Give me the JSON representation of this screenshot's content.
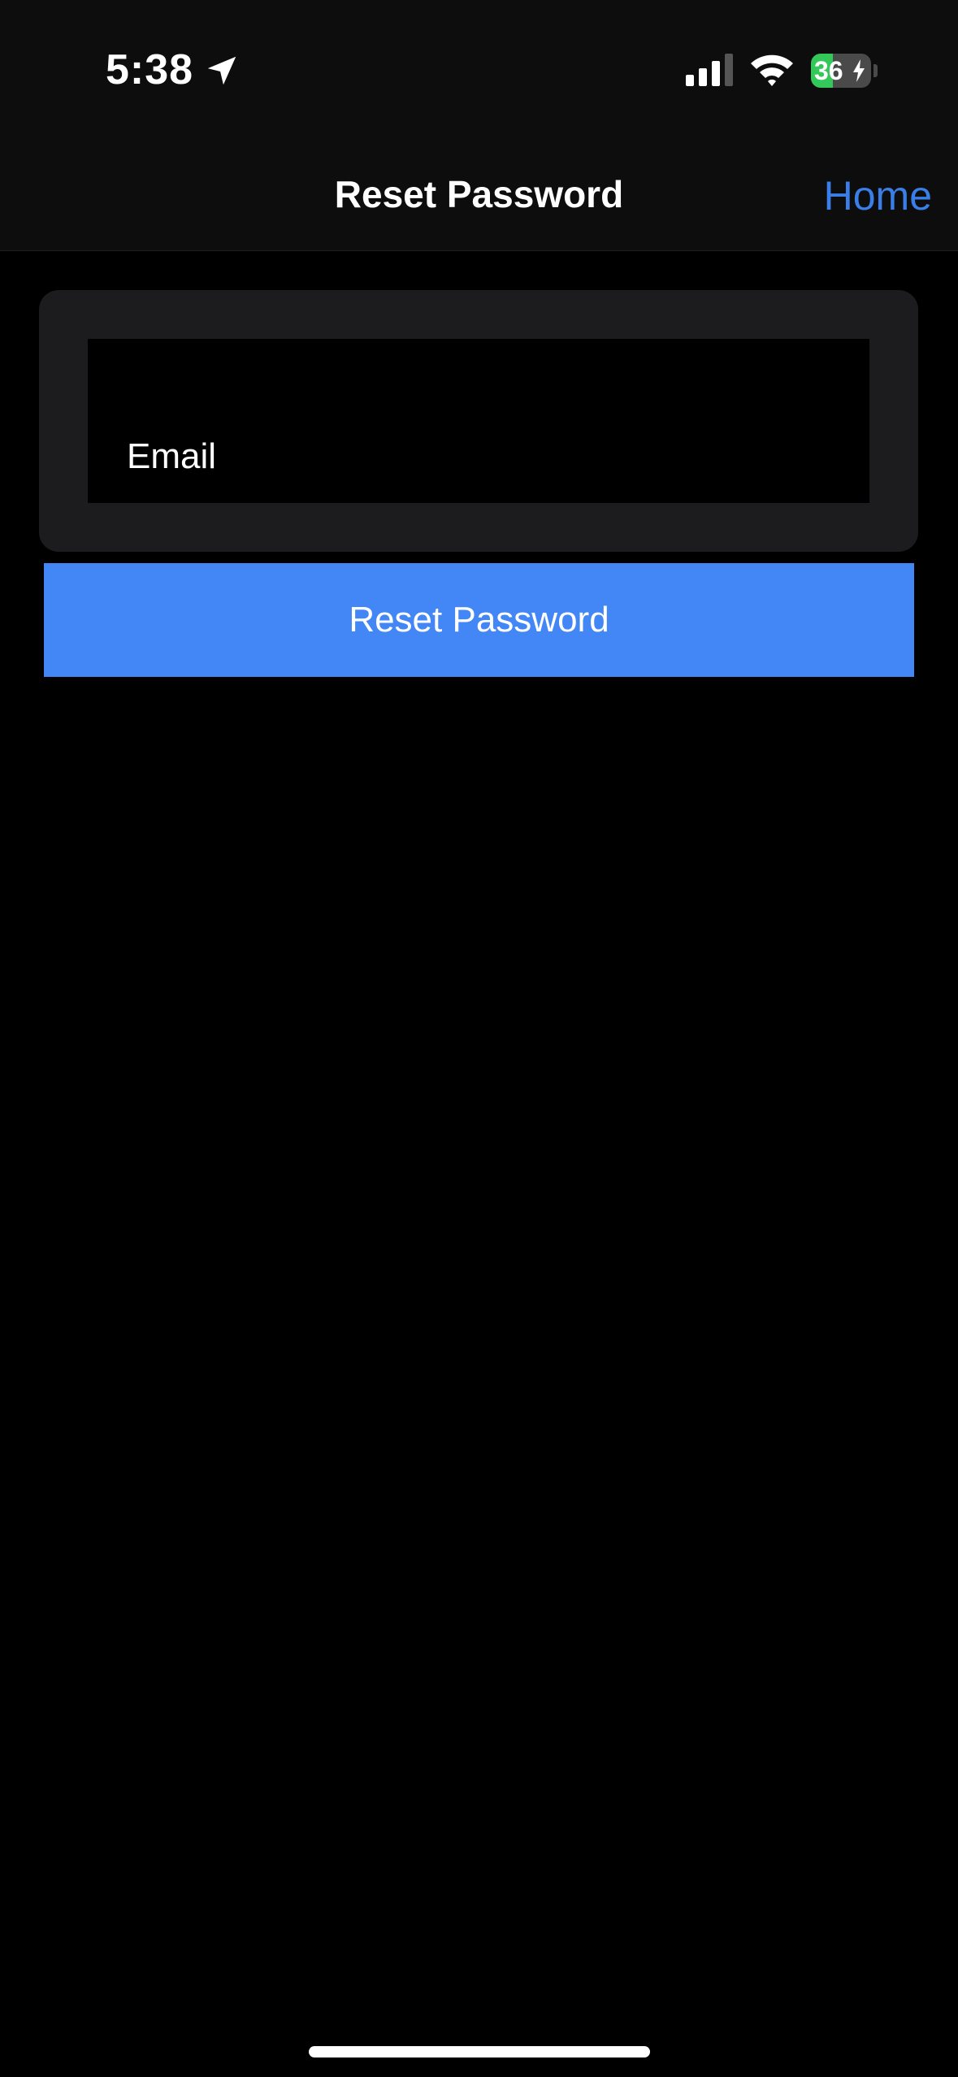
{
  "status_bar": {
    "time": "5:38",
    "location_icon": "location-arrow-icon",
    "signal_icon": "cellular-signal-icon",
    "wifi_icon": "wifi-icon",
    "battery_level": "36",
    "battery_charging": true
  },
  "nav": {
    "title": "Reset Password",
    "home_label": "Home"
  },
  "form": {
    "email_placeholder": "Email",
    "submit_label": "Reset Password"
  },
  "colors": {
    "accent": "#4287f5",
    "link": "#3a7ee8",
    "battery_green": "#34c759",
    "card_bg": "#1c1c1e"
  }
}
